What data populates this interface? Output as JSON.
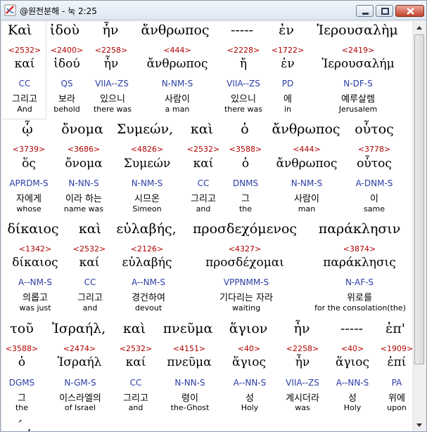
{
  "window": {
    "title": "@원전분해 - 눅 2:25"
  },
  "verse_blocks": [
    {
      "words": [
        {
          "greek": "Καὶ",
          "strongs": "<2532>",
          "lexeme": "καί",
          "parsing": "CC",
          "korean": "그리고",
          "english": "And"
        },
        {
          "greek": "ἰδοὺ",
          "strongs": "<2400>",
          "lexeme": "ἰδού",
          "parsing": "QS",
          "korean": "보라",
          "english": "behold"
        },
        {
          "greek": "ἦν",
          "strongs": "<2258>",
          "lexeme": "ἦν",
          "parsing": "VIIA--ZS",
          "korean": "있으니",
          "english": "there was"
        },
        {
          "greek": "ἄνθρωπος",
          "strongs": "<444>",
          "lexeme": "ἄνθρωπος",
          "parsing": "N-NM-S",
          "korean": "사람이",
          "english": "a man"
        },
        {
          "greek": "-----",
          "strongs": "<2228>",
          "lexeme": "ἤ",
          "parsing": "VIIA--ZS",
          "korean": "있으니",
          "english": "there was"
        },
        {
          "greek": "ἐν",
          "strongs": "<1722>",
          "lexeme": "ἐν",
          "parsing": "PD",
          "korean": "에",
          "english": "in"
        },
        {
          "greek": "Ἰερουσαλὴμ",
          "strongs": "<2419>",
          "lexeme": "Ἰερουσαλήμ",
          "parsing": "N-DF-S",
          "korean": "예루살렘",
          "english": "Jerusalem"
        }
      ]
    },
    {
      "words": [
        {
          "greek": "ᾧ",
          "strongs": "<3739>",
          "lexeme": "ὅς",
          "parsing": "APRDM-S",
          "korean": "자에게",
          "english": "whose"
        },
        {
          "greek": "ὄνομα",
          "strongs": "<3686>",
          "lexeme": "ὄνομα",
          "parsing": "N-NN-S",
          "korean": "이라 하는",
          "english": "name was"
        },
        {
          "greek": "Συμεών,",
          "strongs": "<4826>",
          "lexeme": "Συμεών",
          "parsing": "N-NM-S",
          "korean": "시므온",
          "english": "Simeon"
        },
        {
          "greek": "καὶ",
          "strongs": "<2532>",
          "lexeme": "καί",
          "parsing": "CC",
          "korean": "그리고",
          "english": "and"
        },
        {
          "greek": "ὁ",
          "strongs": "<3588>",
          "lexeme": "ὁ",
          "parsing": "DNMS",
          "korean": "그",
          "english": "the"
        },
        {
          "greek": "ἄνθρωπος",
          "strongs": "<444>",
          "lexeme": "ἄνθρωπος",
          "parsing": "N-NM-S",
          "korean": "사람이",
          "english": "man"
        },
        {
          "greek": "οὗτος",
          "strongs": "<3778>",
          "lexeme": "οὗτος",
          "parsing": "A-DNM-S",
          "korean": "이",
          "english": "same"
        }
      ]
    },
    {
      "words": [
        {
          "greek": "δίκαιος",
          "strongs": "<1342>",
          "lexeme": "δίκαιος",
          "parsing": "A--NM-S",
          "korean": "의롭고",
          "english": "was just"
        },
        {
          "greek": "καὶ",
          "strongs": "<2532>",
          "lexeme": "καί",
          "parsing": "CC",
          "korean": "그리고",
          "english": "and"
        },
        {
          "greek": "εὐλαβής,",
          "strongs": "<2126>",
          "lexeme": "εὐλαβής",
          "parsing": "A--NM-S",
          "korean": "경건하여",
          "english": "devout"
        },
        {
          "greek": "προσδεχόμενος",
          "strongs": "<4327>",
          "lexeme": "προσδέχομαι",
          "parsing": "VPPNMM-S",
          "korean": "기다리는 자라",
          "english": "waiting"
        },
        {
          "greek": "παράκλησιν",
          "strongs": "<3874>",
          "lexeme": "παράκλησις",
          "parsing": "N-AF-S",
          "korean": "위로를",
          "english": "for the consolation(the)"
        }
      ]
    },
    {
      "words": [
        {
          "greek": "τοῦ",
          "strongs": "<3588>",
          "lexeme": "ὁ",
          "parsing": "DGMS",
          "korean": "그",
          "english": "the"
        },
        {
          "greek": "Ἰσραήλ,",
          "strongs": "<2474>",
          "lexeme": "Ἰσραήλ",
          "parsing": "N-GM-S",
          "korean": "이스라엘의",
          "english": "of Israel"
        },
        {
          "greek": "καὶ",
          "strongs": "<2532>",
          "lexeme": "καί",
          "parsing": "CC",
          "korean": "그리고",
          "english": "and"
        },
        {
          "greek": "πνεῦμα",
          "strongs": "<4151>",
          "lexeme": "πνεῦμα",
          "parsing": "N-NN-S",
          "korean": "령이",
          "english": "the-Ghost"
        },
        {
          "greek": "ἅγιον",
          "strongs": "<40>",
          "lexeme": "ἅγιος",
          "parsing": "A--NN-S",
          "korean": "성",
          "english": "Holy"
        },
        {
          "greek": "ἦν",
          "strongs": "<2258>",
          "lexeme": "ἦν",
          "parsing": "VIIA--ZS",
          "korean": "계시더라",
          "english": "was"
        },
        {
          "greek": "-----",
          "strongs": "<40>",
          "lexeme": "ἅγιος",
          "parsing": "A--NN-S",
          "korean": "성",
          "english": "Holy"
        },
        {
          "greek": "ἐπ'",
          "strongs": "<1909>",
          "lexeme": "ἐπί",
          "parsing": "PA",
          "korean": "위에",
          "english": "upon"
        }
      ]
    }
  ],
  "next_row_partial": "´  ,"
}
